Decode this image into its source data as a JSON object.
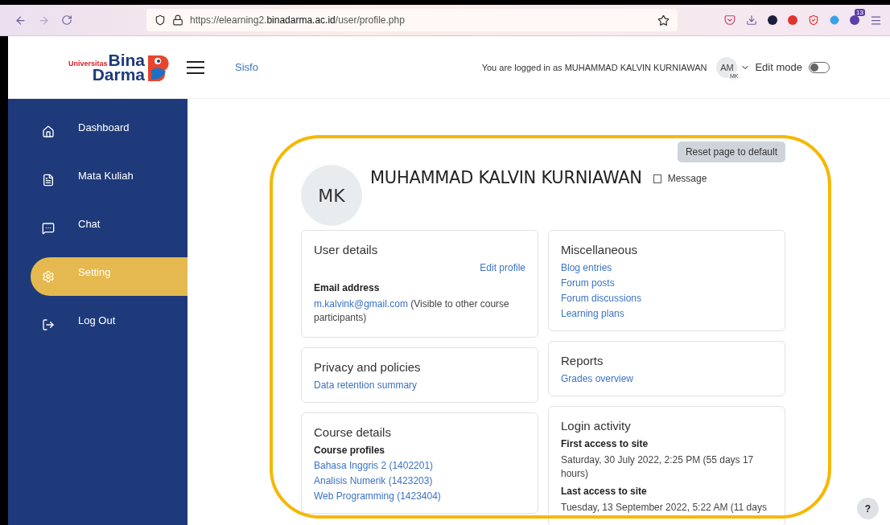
{
  "browser": {
    "url": "https://elearning2.**binadarma.ac.id**/user/profile.php",
    "extension_badge": "13"
  },
  "header": {
    "logo": {
      "prefix": "Universitas",
      "line1": "Bina",
      "line2": "Darma"
    },
    "nav_link": "Sisfo",
    "login_text": "You are logged in as MUHAMMAD KALVIN KURNIAWAN",
    "user_avatar": {
      "initials": "AM",
      "sub_initials": "MK"
    },
    "edit_mode": {
      "label": "Edit mode",
      "on": false
    }
  },
  "sidebar": {
    "items": [
      {
        "label": "Dashboard",
        "selected": false
      },
      {
        "label": "Mata Kuliah",
        "selected": false
      },
      {
        "label": "Chat",
        "selected": false
      },
      {
        "label": "Setting",
        "selected": true
      },
      {
        "label": "Log Out",
        "selected": false
      }
    ]
  },
  "profile": {
    "reset_button": "Reset page to default",
    "avatar_initials": "MK",
    "name": "MUHAMMAD KALVIN KURNIAWAN",
    "message_label": "Message"
  },
  "columns": [
    {
      "cards": [
        {
          "title": "User details",
          "items": [
            {
              "kind": "action",
              "text": "Edit profile"
            },
            {
              "kind": "label",
              "text": "Email address"
            },
            {
              "kind": "email",
              "link": "m.kalvink@gmail.com",
              "text": "(Visible to other course participants)"
            }
          ]
        },
        {
          "title": "Privacy and policies",
          "items": [
            {
              "kind": "link",
              "text": "Data retention summary"
            }
          ]
        },
        {
          "title": "Course details",
          "items": [
            {
              "kind": "label",
              "text": "Course profiles"
            },
            {
              "kind": "link",
              "text": "Bahasa Inggris 2 (1402201)"
            },
            {
              "kind": "link",
              "text": "Analisis Numerik (1423203)"
            },
            {
              "kind": "link",
              "text": "Web Programming (1423404)"
            }
          ]
        }
      ]
    },
    {
      "cards": [
        {
          "title": "Miscellaneous",
          "items": [
            {
              "kind": "link",
              "text": "Blog entries"
            },
            {
              "kind": "link",
              "text": "Forum posts"
            },
            {
              "kind": "link",
              "text": "Forum discussions"
            },
            {
              "kind": "link",
              "text": "Learning plans"
            }
          ]
        },
        {
          "title": "Reports",
          "items": [
            {
              "kind": "link",
              "text": "Grades overview"
            }
          ]
        },
        {
          "title": "Login activity",
          "items": [
            {
              "kind": "label",
              "text": "First access to site"
            },
            {
              "kind": "text",
              "text": "Saturday, 30 July 2022, 2:25 PM  (55 days 17 hours)"
            },
            {
              "kind": "label",
              "text": "Last access to site"
            },
            {
              "kind": "text",
              "text": "Tuesday, 13 September 2022, 5:22 AM  (11 days"
            }
          ]
        }
      ]
    }
  ],
  "help_button": "?"
}
